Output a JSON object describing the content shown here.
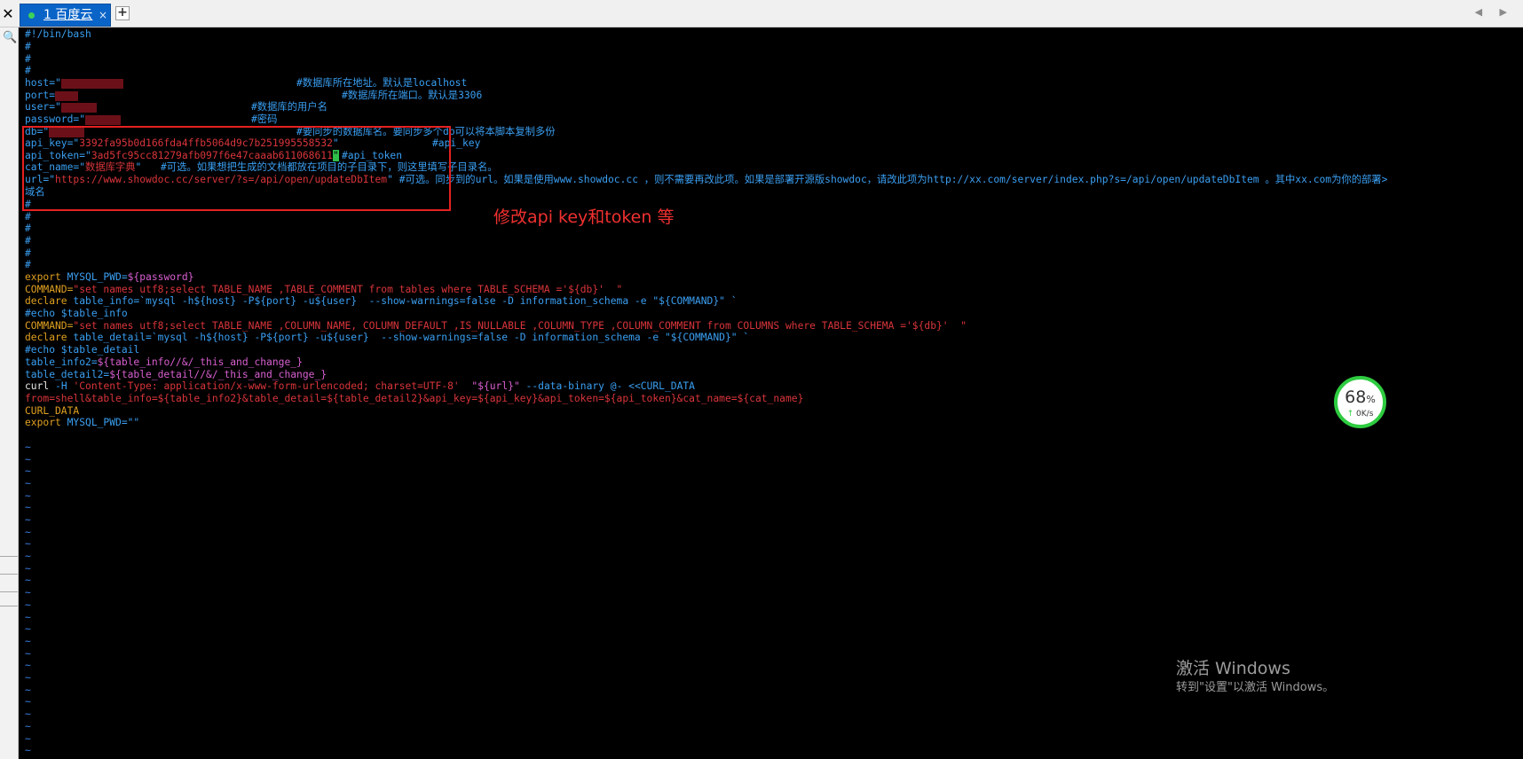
{
  "tabbar": {
    "close_glyph": "✕",
    "tab_label": "1 百度云",
    "tab_close_glyph": "×",
    "new_tab_glyph": "+",
    "nav_glyphs": "◀ ▶"
  },
  "terminal": {
    "shebang": "#!/bin/bash",
    "hash": "#",
    "host_key": "host=\"",
    "host_comment": "#数据库所在地址。默认是localhost",
    "port_key": "port=",
    "port_comment": "#数据库所在端口。默认是3306",
    "user_key": "user=\"",
    "user_comment": "#数据库的用户名",
    "password_key": "password=\"",
    "password_comment": "#密码",
    "db_key": "db=\"",
    "db_comment": "#要同步的数据库名。要同步多个db可以将本脚本复制多份",
    "api_key_key": "api_key=\"",
    "api_key_value": "3392fa95b0d166fda4ffb5064d9c7b251995558532",
    "api_key_quote": "\"",
    "api_key_comment": "#api_key",
    "api_token_key": "api_token=\"",
    "api_token_value": "3ad5fc95cc81279afb097f6e47caaab611068611",
    "api_token_cursor": "\"",
    "api_token_comment": "#api_token",
    "cat_name_key": "cat_name=\"",
    "cat_name_value": "数据库字典",
    "cat_name_quote": "\"",
    "cat_name_comment": "#可选。如果想把生成的文档都放在项目的子目录下，则这里填写子目录名。",
    "url_key": "url=\"",
    "url_value": "https://www.showdoc.cc/server/?s=/api/open/updateDbItem",
    "url_quote": "\"",
    "url_comment": "#可选。同步到的url。如果是使用www.showdoc.cc ，则不需要再改此项。如果是部署开源版showdoc，请改此项为http://xx.com/server/index.php?s=/api/open/updateDbItem 。其中xx.com为你的部署>",
    "url_comment_wrap": "域名",
    "export_kw": "export",
    "export_pwd": " MYSQL_PWD=",
    "export_pwd_var": "${password}",
    "command1_key": "COMMAND=",
    "command1_value": "\"set names utf8;select TABLE_NAME ,TABLE_COMMENT from tables where TABLE_SCHEMA ='${db}'  \"",
    "declare1_kw": "declare",
    "declare1_rest": " table_info=`mysql -h${host} -P${port} -u${user}  --show-warnings=false -D information_schema -e \"${COMMAND}\" `",
    "echo1": "#echo $table_info",
    "command2_key": "COMMAND=",
    "command2_value": "\"set names utf8;select TABLE_NAME ,COLUMN_NAME, COLUMN_DEFAULT ,IS_NULLABLE ,COLUMN_TYPE ,COLUMN_COMMENT from COLUMNS where TABLE_SCHEMA ='${db}'  \"",
    "declare2_kw": "declare",
    "declare2_rest": " table_detail=`mysql -h${host} -P${port} -u${user}  --show-warnings=false -D information_schema -e \"${COMMAND}\" `",
    "echo2": "#echo $table_detail",
    "table_info2_key": "table_info2=",
    "table_info2_value": "${table_info//&/_this_and_change_}",
    "table_detail2_key": "table_detail2=",
    "table_detail2_value": "${table_detail//&/_this_and_change_}",
    "curl_cmd": "curl",
    "curl_h": " -H ",
    "curl_header": "'Content-Type: application/x-www-form-urlencoded; charset=UTF-8'",
    "curl_url": "  \"${url}\"",
    "curl_rest": " --data-binary @- <<CURL_DATA",
    "from_line": "from=shell&table_info=${table_info2}&table_detail=${table_detail2}&api_key=${api_key}&api_token=${api_token}&cat_name=${cat_name}",
    "curl_data_end": "CURL_DATA",
    "export2_kw": "export",
    "export2_rest": " MYSQL_PWD=\"\"",
    "tilde": "~"
  },
  "annotation": "修改api key和token 等",
  "speed_widget": {
    "percent": "68",
    "percent_sign": "%",
    "arrow": "↑",
    "rate": "0K/s"
  },
  "watermark": {
    "title": "激活 Windows",
    "subtitle": "转到\"设置\"以激活 Windows。"
  },
  "colors": {
    "comment": "#3a9ff2",
    "string": "#d9353b",
    "keyword": "#e0a020",
    "variable": "#d85fd0",
    "annotation_red": "#f03030",
    "tab_blue": "#0a64c8",
    "widget_green": "#2ecc40"
  }
}
